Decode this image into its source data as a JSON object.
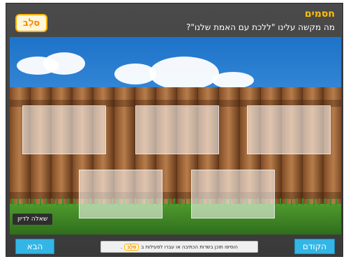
{
  "header": {
    "logo_text": "סל֤ב",
    "title": "חסמים",
    "question": "מה מקשה עלינו \"ללכת עם האמת שלנו\"?"
  },
  "stage": {
    "hint_button": "שאלה לדיון"
  },
  "footer": {
    "back_label": "הבא",
    "prev_label": "הקודם",
    "status_text": "הוסיפו תוכן בשדות הכתיבה או עברו לפעילות ב",
    "status_logo": "סל֤ב",
    "status_end": "."
  }
}
